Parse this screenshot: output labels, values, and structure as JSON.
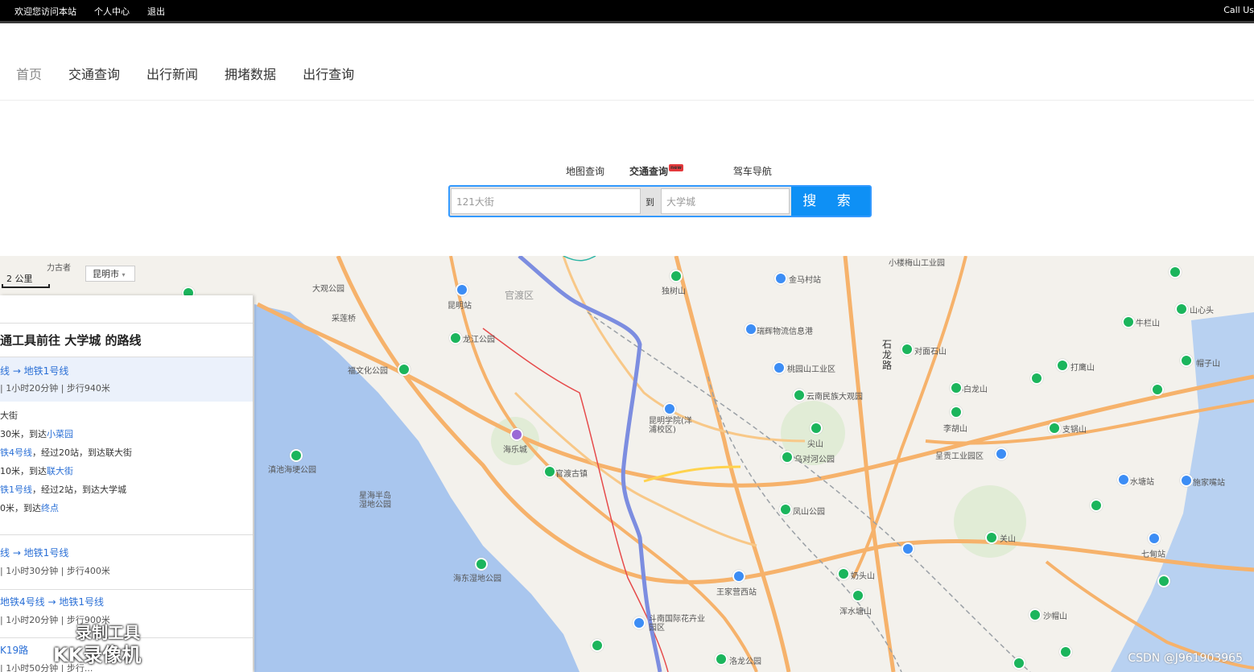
{
  "topbar": {
    "welcome": "欢迎您访问本站",
    "profile": "个人中心",
    "logout": "退出",
    "right_text": "Call Us"
  },
  "nav": {
    "items": [
      "首页",
      "交通查询",
      "出行新闻",
      "拥堵数据",
      "出行查询"
    ]
  },
  "search": {
    "tabs": [
      "地图查询",
      "交通查询",
      "驾车导航"
    ],
    "new_badge": "new",
    "from_value": "121大街",
    "to_label": "到",
    "to_value": "大学城",
    "button": "搜 索"
  },
  "map": {
    "scale": "2 公里",
    "city": "昆明市",
    "labels": [
      "力古者",
      "大观公园",
      "采莲桥",
      "昆明站",
      "官渡区",
      "龙江公园",
      "福文化公园",
      "海乐城",
      "官渡古镇",
      "星海半岛湿地公园",
      "滇池海埂公园",
      "海东湿地公园",
      "昆明学院(洋浦校区)",
      "金马村站",
      "瑞辉物流信息港",
      "桃园山工业区",
      "云南民族大观园",
      "尖山",
      "乌对河公园",
      "凤山公园",
      "王家营西站",
      "斗南国际花卉业园区",
      "石龙路",
      "对面石山",
      "小白龙山",
      "李胡山",
      "支锅山",
      "呈贡工业园区",
      "打鹰山",
      "帽子山",
      "牛栏山",
      "山心头",
      "水塘站",
      "施家嘴站",
      "七甸站",
      "奶头山",
      "沙帽山",
      "浑水塘山",
      "关山",
      "洛龙公园",
      "小楼梅山工业园",
      "独树山"
    ]
  },
  "panel": {
    "title": "通工具前往 大学城 的路线",
    "routes": [
      {
        "name": "线 → 地铁1号线",
        "meta": "| 1小时20分钟 | 步行940米"
      },
      {
        "name": "线 → 地铁1号线",
        "meta": "| 1小时30分钟 | 步行400米"
      },
      {
        "name": "地铁4号线 → 地铁1号线",
        "meta": "| 1小时20分钟 | 步行900米"
      },
      {
        "name": "K19路",
        "meta": "| 1小时50分钟 | 步行..."
      }
    ],
    "steps": [
      {
        "pre": "大街",
        "hl": "",
        "post": ""
      },
      {
        "pre": "30米，到达",
        "hl": "小菜园",
        "post": ""
      },
      {
        "pre": "",
        "hl": "铁4号线",
        "post": "，经过20站，到达联大街"
      },
      {
        "pre": "10米，到达",
        "hl": "联大街",
        "post": ""
      },
      {
        "pre": "",
        "hl": "铁1号线",
        "post": "，经过2站，到达大学城"
      },
      {
        "pre": "0米，到达",
        "hl": "终点",
        "post": ""
      }
    ]
  },
  "overlay": {
    "watermark_line1": "录制工具",
    "watermark_line2": "KK录像机",
    "csdn": "CSDN @J961903965"
  }
}
